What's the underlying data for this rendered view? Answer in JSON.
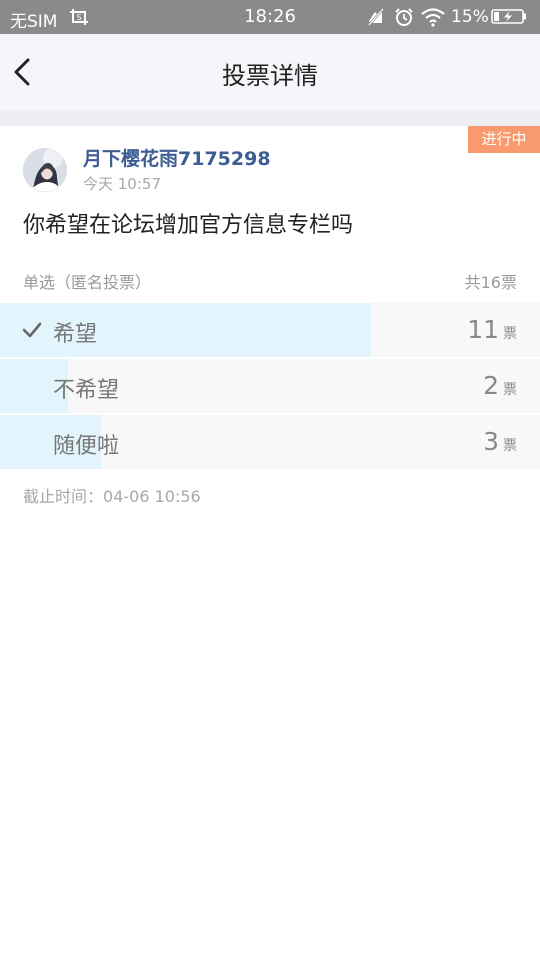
{
  "status_bar": {
    "sim": "无SIM",
    "time": "18:26",
    "battery_pct": "15%"
  },
  "header": {
    "title": "投票详情"
  },
  "post": {
    "status_tag": "进行中",
    "username": "月下樱花雨7175298",
    "time": "今天 10:57",
    "question": "你希望在论坛增加官方信息专栏吗",
    "vote_type": "单选（匿名投票）",
    "total_votes": "共16票",
    "deadline_label": "截止时间：",
    "deadline_value": "04-06 10:56"
  },
  "options": [
    {
      "label": "希望",
      "count": "11",
      "unit": "票",
      "fraction": 0.6875,
      "selected": true
    },
    {
      "label": "不希望",
      "count": "2",
      "unit": "票",
      "fraction": 0.125,
      "selected": false
    },
    {
      "label": "随便啦",
      "count": "3",
      "unit": "票",
      "fraction": 0.1875,
      "selected": false
    }
  ],
  "colors": {
    "accent_blue": "#3d5d93",
    "bar_fill": "#e2f5fd",
    "status_tag": "#f99a6e"
  }
}
